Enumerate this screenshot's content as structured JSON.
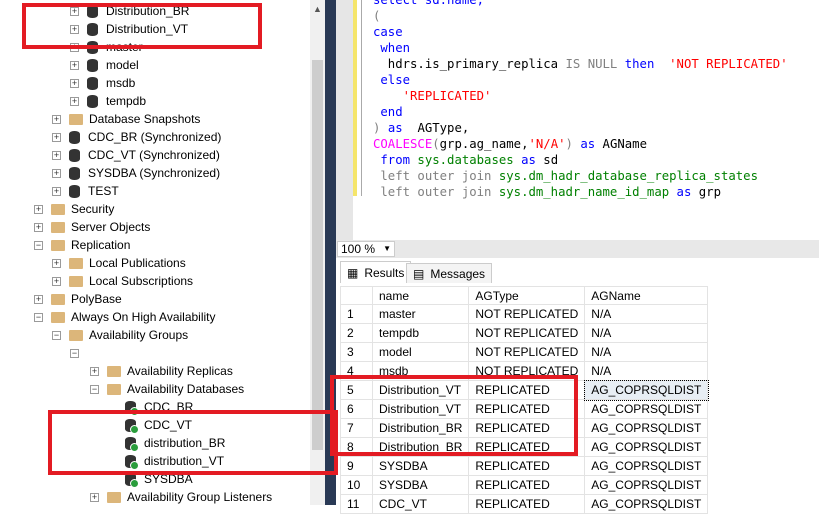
{
  "tree": [
    {
      "label": "Distribution_BR",
      "icon": "database",
      "exp": "+",
      "lvl": 4
    },
    {
      "label": "Distribution_VT",
      "icon": "database",
      "exp": "+",
      "lvl": 4
    },
    {
      "label": "master",
      "icon": "database",
      "exp": "+",
      "lvl": 4
    },
    {
      "label": "model",
      "icon": "database",
      "exp": "+",
      "lvl": 4
    },
    {
      "label": "msdb",
      "icon": "database",
      "exp": "+",
      "lvl": 4
    },
    {
      "label": "tempdb",
      "icon": "database",
      "exp": "+",
      "lvl": 4
    },
    {
      "label": "Database Snapshots",
      "icon": "folder",
      "exp": "+",
      "lvl": 3
    },
    {
      "label": "CDC_BR (Synchronized)",
      "icon": "database",
      "exp": "+",
      "lvl": 3
    },
    {
      "label": "CDC_VT (Synchronized)",
      "icon": "database",
      "exp": "+",
      "lvl": 3
    },
    {
      "label": "SYSDBA (Synchronized)",
      "icon": "database",
      "exp": "+",
      "lvl": 3
    },
    {
      "label": "TEST",
      "icon": "database",
      "exp": "+",
      "lvl": 3
    },
    {
      "label": "Security",
      "icon": "folder",
      "exp": "+",
      "lvl": 2
    },
    {
      "label": "Server Objects",
      "icon": "folder",
      "exp": "+",
      "lvl": 2
    },
    {
      "label": "Replication",
      "icon": "folder",
      "exp": "-",
      "lvl": 2
    },
    {
      "label": "Local Publications",
      "icon": "folder",
      "exp": "+",
      "lvl": 3
    },
    {
      "label": "Local Subscriptions",
      "icon": "folder",
      "exp": "+",
      "lvl": 3
    },
    {
      "label": "PolyBase",
      "icon": "folder",
      "exp": "+",
      "lvl": 2
    },
    {
      "label": "Always On High Availability",
      "icon": "folder",
      "exp": "-",
      "lvl": 2
    },
    {
      "label": "Availability Groups",
      "icon": "folder",
      "exp": "-",
      "lvl": 3
    },
    {
      "label": "",
      "icon": "none",
      "exp": "-",
      "lvl": 4
    },
    {
      "label": "Availability Replicas",
      "icon": "folder",
      "exp": "+",
      "lvl": 5
    },
    {
      "label": "Availability Databases",
      "icon": "folder",
      "exp": "-",
      "lvl": 5
    },
    {
      "label": "CDC_BR",
      "icon": "agdb",
      "exp": "",
      "lvl": 6
    },
    {
      "label": "CDC_VT",
      "icon": "agdb",
      "exp": "",
      "lvl": 6
    },
    {
      "label": "distribution_BR",
      "icon": "agdb",
      "exp": "",
      "lvl": 6
    },
    {
      "label": "distribution_VT",
      "icon": "agdb",
      "exp": "",
      "lvl": 6
    },
    {
      "label": "SYSDBA",
      "icon": "agdb",
      "exp": "",
      "lvl": 6
    },
    {
      "label": "Availability Group Listeners",
      "icon": "folder",
      "exp": "+",
      "lvl": 5
    }
  ],
  "code": [
    [
      [
        "select sd.name,",
        "kw"
      ]
    ],
    [
      [
        "(",
        "gr"
      ]
    ],
    [
      [
        "case",
        "kw"
      ]
    ],
    [
      [
        " when",
        "kw"
      ]
    ],
    [
      [
        "  hdrs.is_primary_replica ",
        ""
      ],
      [
        "IS NULL ",
        "gr"
      ],
      [
        "then  ",
        "kw"
      ],
      [
        "'NOT REPLICATED'",
        "st"
      ]
    ],
    [
      [
        " else",
        "kw"
      ]
    ],
    [
      [
        "    'REPLICATED'",
        "st"
      ]
    ],
    [
      [
        " end",
        "kw"
      ]
    ],
    [
      [
        ") ",
        "gr"
      ],
      [
        "as  ",
        "kw"
      ],
      [
        "AGType,",
        ""
      ]
    ],
    [
      [
        "COALESCE",
        "fn"
      ],
      [
        "(",
        "gr"
      ],
      [
        "grp.ag_name,",
        ""
      ],
      [
        "'N/A'",
        "st"
      ],
      [
        ") ",
        "gr"
      ],
      [
        "as ",
        "kw"
      ],
      [
        "AGName",
        ""
      ]
    ],
    [
      [
        " from ",
        "kw"
      ],
      [
        "sys.databases ",
        "sy"
      ],
      [
        "as ",
        "kw"
      ],
      [
        "sd",
        ""
      ]
    ],
    [
      [
        " left outer join ",
        "gr"
      ],
      [
        "sys.dm_hadr_database_replica_states",
        "sy"
      ]
    ],
    [
      [
        " left outer join ",
        "gr"
      ],
      [
        "sys.dm_hadr_name_id_map ",
        "sy"
      ],
      [
        "as ",
        "kw"
      ],
      [
        "grp",
        ""
      ]
    ]
  ],
  "zoom": "100 %",
  "tabs": {
    "results": "Results",
    "messages": "Messages"
  },
  "grid": {
    "columns": [
      "name",
      "AGType",
      "AGName"
    ],
    "rows": [
      [
        "1",
        "master",
        "NOT REPLICATED",
        "N/A"
      ],
      [
        "2",
        "tempdb",
        "NOT REPLICATED",
        "N/A"
      ],
      [
        "3",
        "model",
        "NOT REPLICATED",
        "N/A"
      ],
      [
        "4",
        "msdb",
        "NOT REPLICATED",
        "N/A"
      ],
      [
        "5",
        "Distribution_VT",
        "REPLICATED",
        "AG_COPRSQLDIST"
      ],
      [
        "6",
        "Distribution_VT",
        "REPLICATED",
        "AG_COPRSQLDIST"
      ],
      [
        "7",
        "Distribution_BR",
        "REPLICATED",
        "AG_COPRSQLDIST"
      ],
      [
        "8",
        "Distribution_BR",
        "REPLICATED",
        "AG_COPRSQLDIST"
      ],
      [
        "9",
        "SYSDBA",
        "REPLICATED",
        "AG_COPRSQLDIST"
      ],
      [
        "10",
        "SYSDBA",
        "REPLICATED",
        "AG_COPRSQLDIST"
      ],
      [
        "11",
        "CDC_VT",
        "REPLICATED",
        "AG_COPRSQLDIST"
      ]
    ]
  },
  "highlight_color": "#e31b23"
}
